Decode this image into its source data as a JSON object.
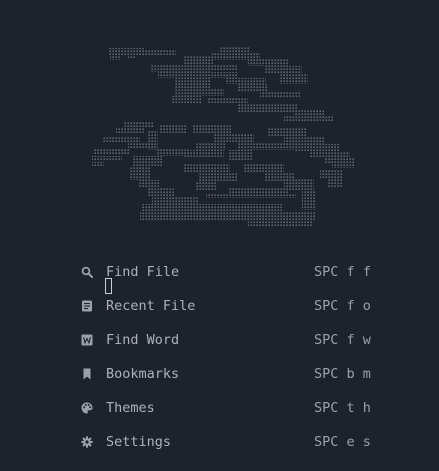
{
  "colors": {
    "background": "#1e222a",
    "logo": "#5c6370",
    "icon": "#9aa1ad",
    "text": "#abb2bf"
  },
  "menu": {
    "items": [
      {
        "icon": "search-icon",
        "label": "Find File",
        "shortcut": "SPC f f"
      },
      {
        "icon": "file-text-icon",
        "label": "Recent File",
        "shortcut": "SPC f o"
      },
      {
        "icon": "word-icon",
        "label": "Find Word",
        "shortcut": "SPC f w"
      },
      {
        "icon": "bookmark-icon",
        "label": "Bookmarks",
        "shortcut": "SPC b m"
      },
      {
        "icon": "palette-icon",
        "label": "Themes",
        "shortcut": "SPC t h"
      },
      {
        "icon": "gear-icon",
        "label": "Settings",
        "shortcut": "SPC e s"
      }
    ]
  }
}
